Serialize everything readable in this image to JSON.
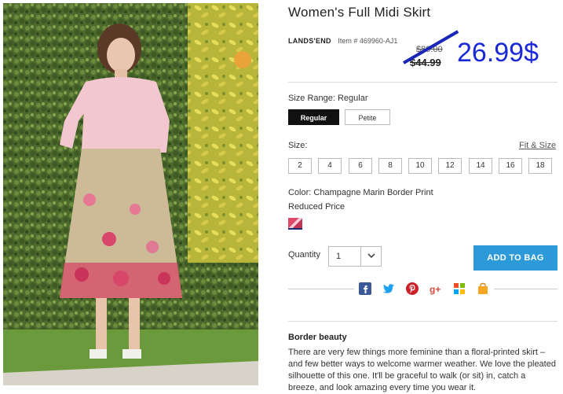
{
  "product": {
    "title": "Women's Full Midi Skirt",
    "brand": "LANDS'END",
    "item_number": "Item # 469960-AJ1",
    "original_price": "$89.00",
    "sale_price": "$44.99",
    "new_price": "26.99$"
  },
  "size_range": {
    "label": "Size Range: Regular",
    "options": [
      "Regular",
      "Petite"
    ],
    "selected": "Regular"
  },
  "size": {
    "label": "Size:",
    "fit_link": "Fit & Size",
    "options": [
      "2",
      "4",
      "6",
      "8",
      "10",
      "12",
      "14",
      "16",
      "18"
    ]
  },
  "color": {
    "label": "Color: Champagne Marin Border Print",
    "price_note": "Reduced Price",
    "swatch_colors": [
      "#e04a6a",
      "#f5d0d8",
      "#c23456"
    ]
  },
  "quantity": {
    "label": "Quantity",
    "value": "1"
  },
  "cart": {
    "add_label": "ADD TO BAG",
    "button_color": "#2c9ad8"
  },
  "share": {
    "icons": [
      "facebook-icon",
      "twitter-icon",
      "pinterest-icon",
      "google-plus-icon",
      "windows-live-icon",
      "bag-share-icon"
    ]
  },
  "description": {
    "title": "Border beauty",
    "text": "There are very few things more feminine than a floral-printed skirt – and few better ways to welcome warmer weather. We love the pleated silhouette of this one. It'll be graceful to walk (or sit) in, catch a breeze, and look amazing every time you wear it."
  },
  "accent_colors": {
    "annotation_blue": "#1a28d8",
    "selected_black": "#111111"
  }
}
